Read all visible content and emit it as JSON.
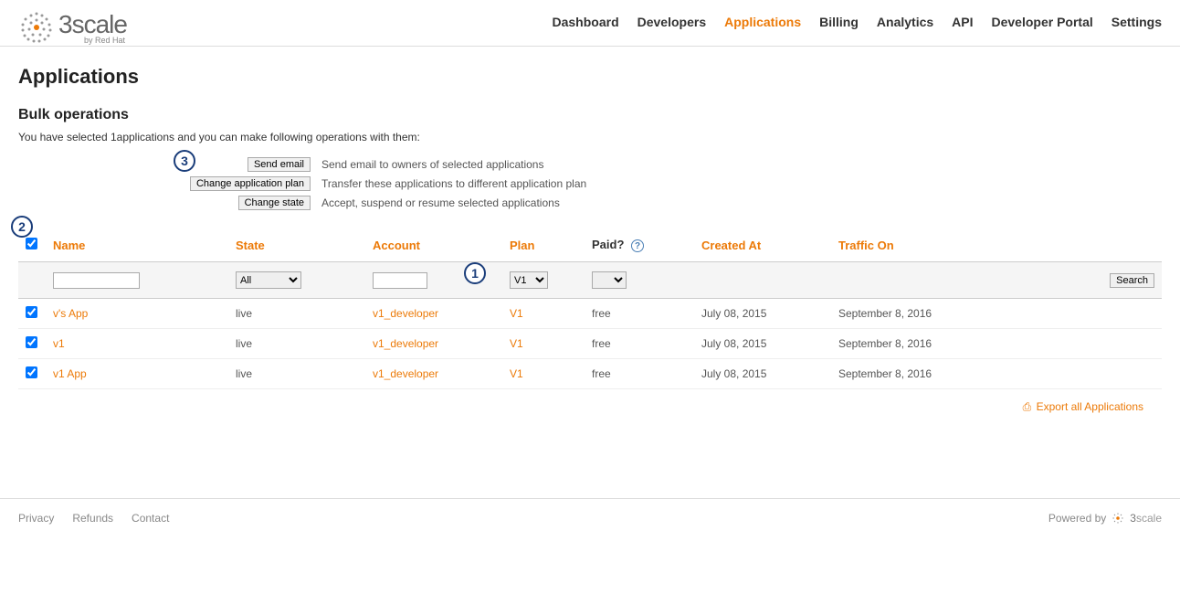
{
  "brand": {
    "name": "3scale",
    "byline": "by Red Hat"
  },
  "nav": {
    "dashboard": "Dashboard",
    "developers": "Developers",
    "applications": "Applications",
    "billing": "Billing",
    "analytics": "Analytics",
    "api": "API",
    "portal": "Developer Portal",
    "settings": "Settings"
  },
  "page": {
    "title": "Applications"
  },
  "bulk": {
    "heading": "Bulk operations",
    "desc": "You have selected 1applications and you can make following operations with them:",
    "send_email_btn": "Send email",
    "send_email_desc": "Send email to owners of selected applications",
    "change_plan_btn": "Change application plan",
    "change_plan_desc": "Transfer these applications to different application plan",
    "change_state_btn": "Change state",
    "change_state_desc": "Accept, suspend or resume selected applications"
  },
  "columns": {
    "name": "Name",
    "state": "State",
    "account": "Account",
    "plan": "Plan",
    "paid": "Paid?",
    "created": "Created At",
    "traffic": "Traffic On"
  },
  "filters": {
    "state_selected": "All",
    "plan_selected": "V1",
    "search_btn": "Search"
  },
  "rows": [
    {
      "name": "v's App",
      "state": "live",
      "account": "v1_developer",
      "plan": "V1",
      "paid": "free",
      "created": "July 08, 2015",
      "traffic": "September 8, 2016"
    },
    {
      "name": "v1",
      "state": "live",
      "account": "v1_developer",
      "plan": "V1",
      "paid": "free",
      "created": "July 08, 2015",
      "traffic": "September 8, 2016"
    },
    {
      "name": "v1 App",
      "state": "live",
      "account": "v1_developer",
      "plan": "V1",
      "paid": "free",
      "created": "July 08, 2015",
      "traffic": "September 8, 2016"
    }
  ],
  "export": {
    "label": "Export all Applications"
  },
  "footer": {
    "privacy": "Privacy",
    "refunds": "Refunds",
    "contact": "Contact",
    "powered": "Powered by",
    "powered_brand": "3scale"
  },
  "annotations": {
    "a1": "1",
    "a2": "2",
    "a3": "3"
  }
}
